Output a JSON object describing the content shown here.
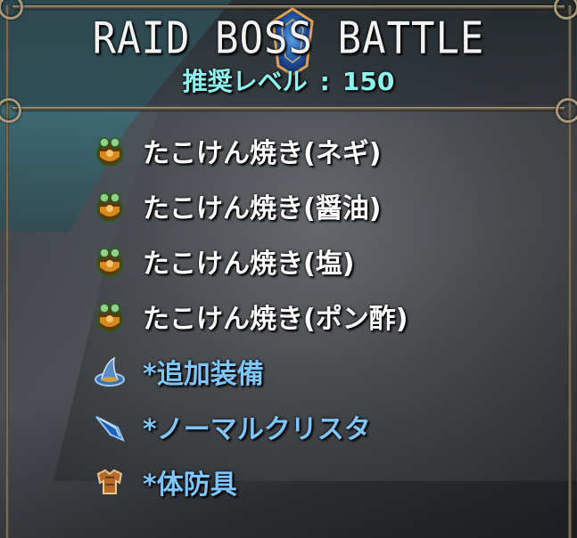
{
  "header": {
    "title": "RAID BOSS BATTLE",
    "level_label": "推奨レベル",
    "level_sep": ":",
    "level_value": "150"
  },
  "drops": [
    {
      "label": "たこけん焼き(ネギ)",
      "icon": "takoyaki-icon",
      "color": "white"
    },
    {
      "label": "たこけん焼き(醤油)",
      "icon": "takoyaki-icon",
      "color": "white"
    },
    {
      "label": "たこけん焼き(塩)",
      "icon": "takoyaki-icon",
      "color": "white"
    },
    {
      "label": "たこけん焼き(ポン酢)",
      "icon": "takoyaki-icon",
      "color": "white"
    },
    {
      "label": "*追加装備",
      "icon": "hat-icon",
      "color": "blue"
    },
    {
      "label": "*ノーマルクリスタ",
      "icon": "crystal-icon",
      "color": "blue"
    },
    {
      "label": "*体防具",
      "icon": "armor-icon",
      "color": "blue"
    }
  ],
  "colors": {
    "title": "#f2f2f2",
    "level": "#8ef4f0",
    "item_white": "#ffffff",
    "item_blue": "#7dc6ff",
    "frame": "#a8987a"
  }
}
